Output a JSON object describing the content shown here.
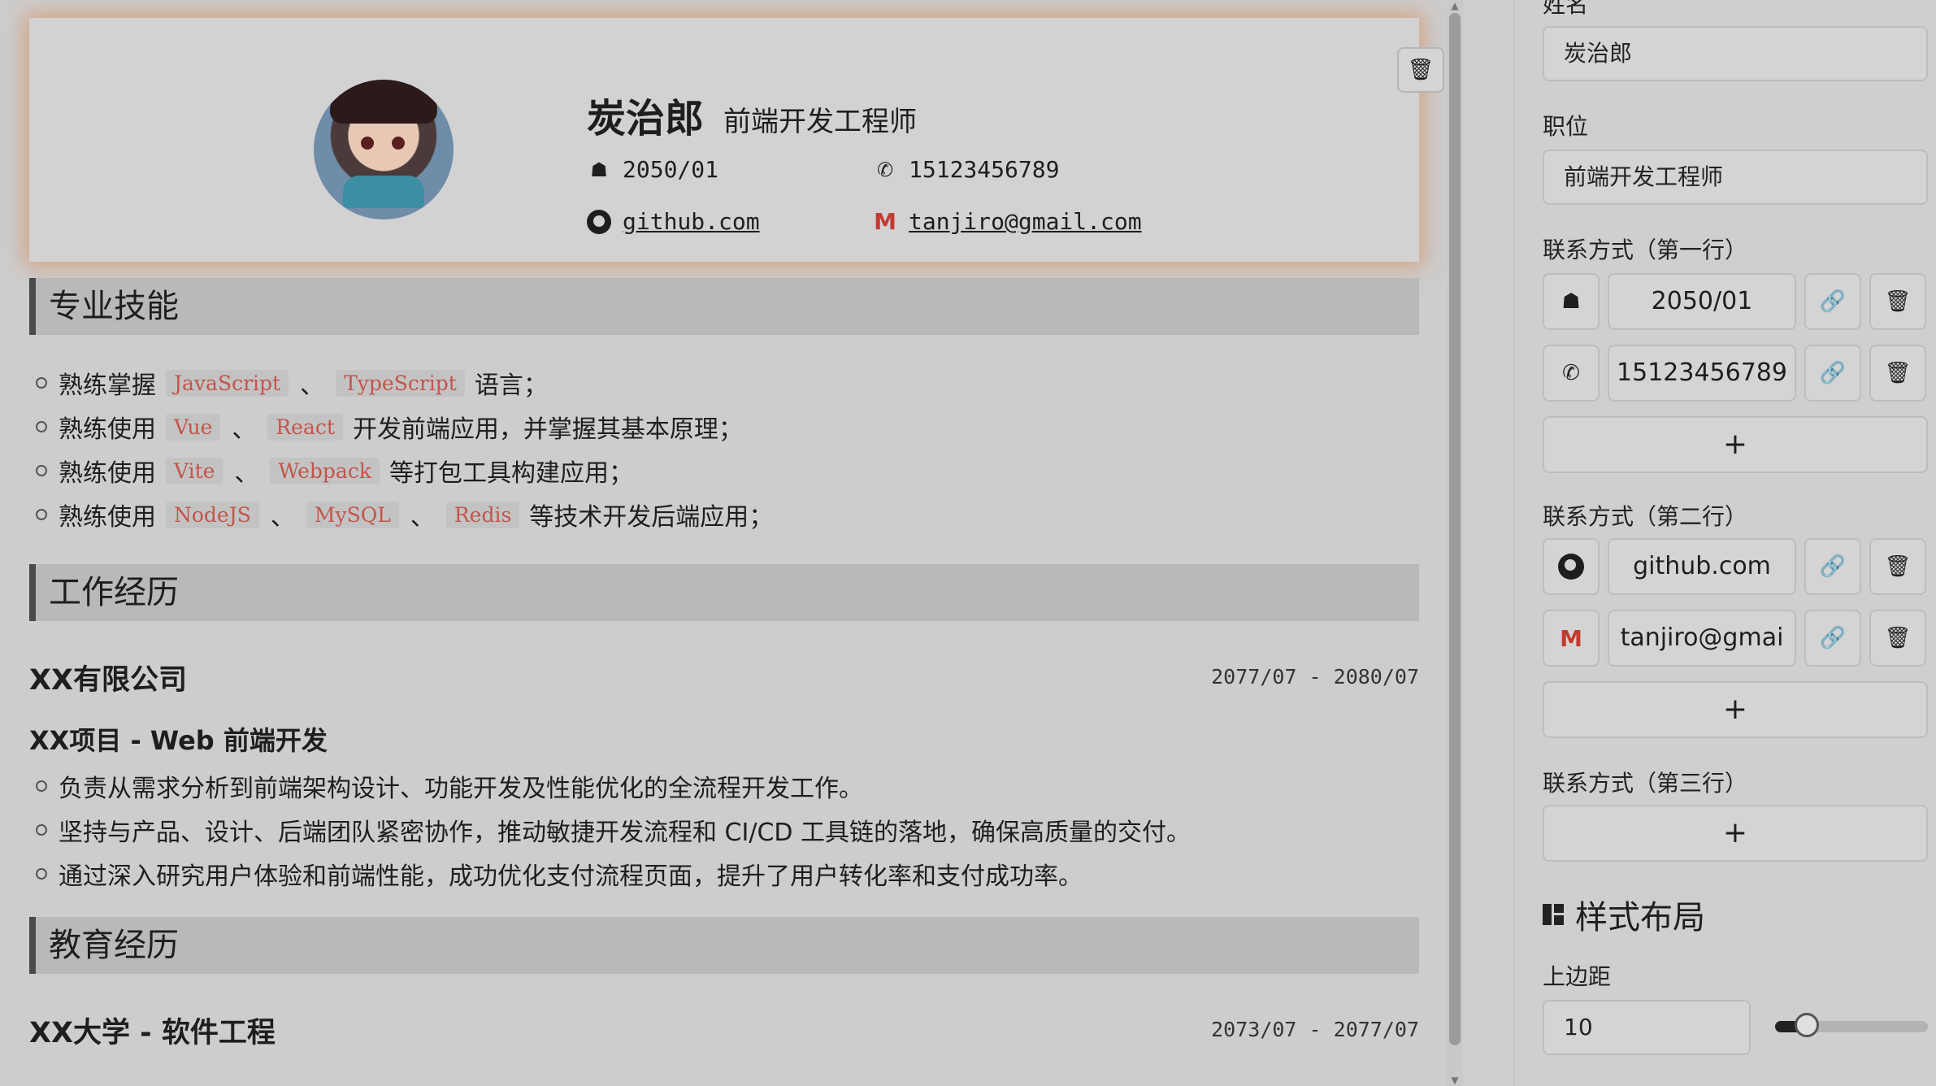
{
  "resume": {
    "name": "炭治郎",
    "role": "前端开发工程师",
    "birth": "2050/01",
    "phone": "15123456789",
    "github": "github.com",
    "email": "tanjiro@gmail.com"
  },
  "skills": {
    "title": "专业技能",
    "items": [
      {
        "pre": "熟练掌握",
        "tags": [
          "JavaScript",
          "TypeScript"
        ],
        "post": "语言；"
      },
      {
        "pre": "熟练使用",
        "tags": [
          "Vue",
          "React"
        ],
        "post": "开发前端应用，并掌握其基本原理；"
      },
      {
        "pre": "熟练使用",
        "tags": [
          "Vite",
          "Webpack"
        ],
        "post": "等打包工具构建应用；"
      },
      {
        "pre": "熟练使用",
        "tags": [
          "NodeJS",
          "MySQL",
          "Redis"
        ],
        "post": "等技术开发后端应用；"
      }
    ],
    "separator": "、"
  },
  "work": {
    "title": "工作经历",
    "company": "XX有限公司",
    "date": "2077/07 - 2080/07",
    "project": "XX项目 - Web 前端开发",
    "items": [
      "负责从需求分析到前端架构设计、功能开发及性能优化的全流程开发工作。",
      "坚持与产品、设计、后端团队紧密协作，推动敏捷开发流程和 CI/CD 工具链的落地，确保高质量的交付。",
      "通过深入研究用户体验和前端性能，成功优化支付流程页面，提升了用户转化率和支付成功率。"
    ]
  },
  "education": {
    "title": "教育经历",
    "school": "XX大学 - 软件工程",
    "date": "2073/07 - 2077/07"
  },
  "editor": {
    "name_label": "姓名",
    "name_value": "炭治郎",
    "role_label": "职位",
    "role_value": "前端开发工程师",
    "row1_label": "联系方式（第一行）",
    "row1": [
      "2050/01",
      "15123456789"
    ],
    "row2_label": "联系方式（第二行）",
    "row2": [
      "github.com",
      "tanjiro@gmai"
    ],
    "row3_label": "联系方式（第三行）",
    "add_label": "+",
    "style_heading": "样式布局",
    "margin_label": "上边距",
    "margin_value": "10",
    "margin_slider_fraction": 0.1
  },
  "colors": {
    "accent_glow": "#d6966e",
    "tag_text": "#c2554a"
  },
  "icons": [
    "cake-icon",
    "phone-icon",
    "github-icon",
    "gmail-icon",
    "trash-icon",
    "link-icon",
    "layout-icon"
  ]
}
